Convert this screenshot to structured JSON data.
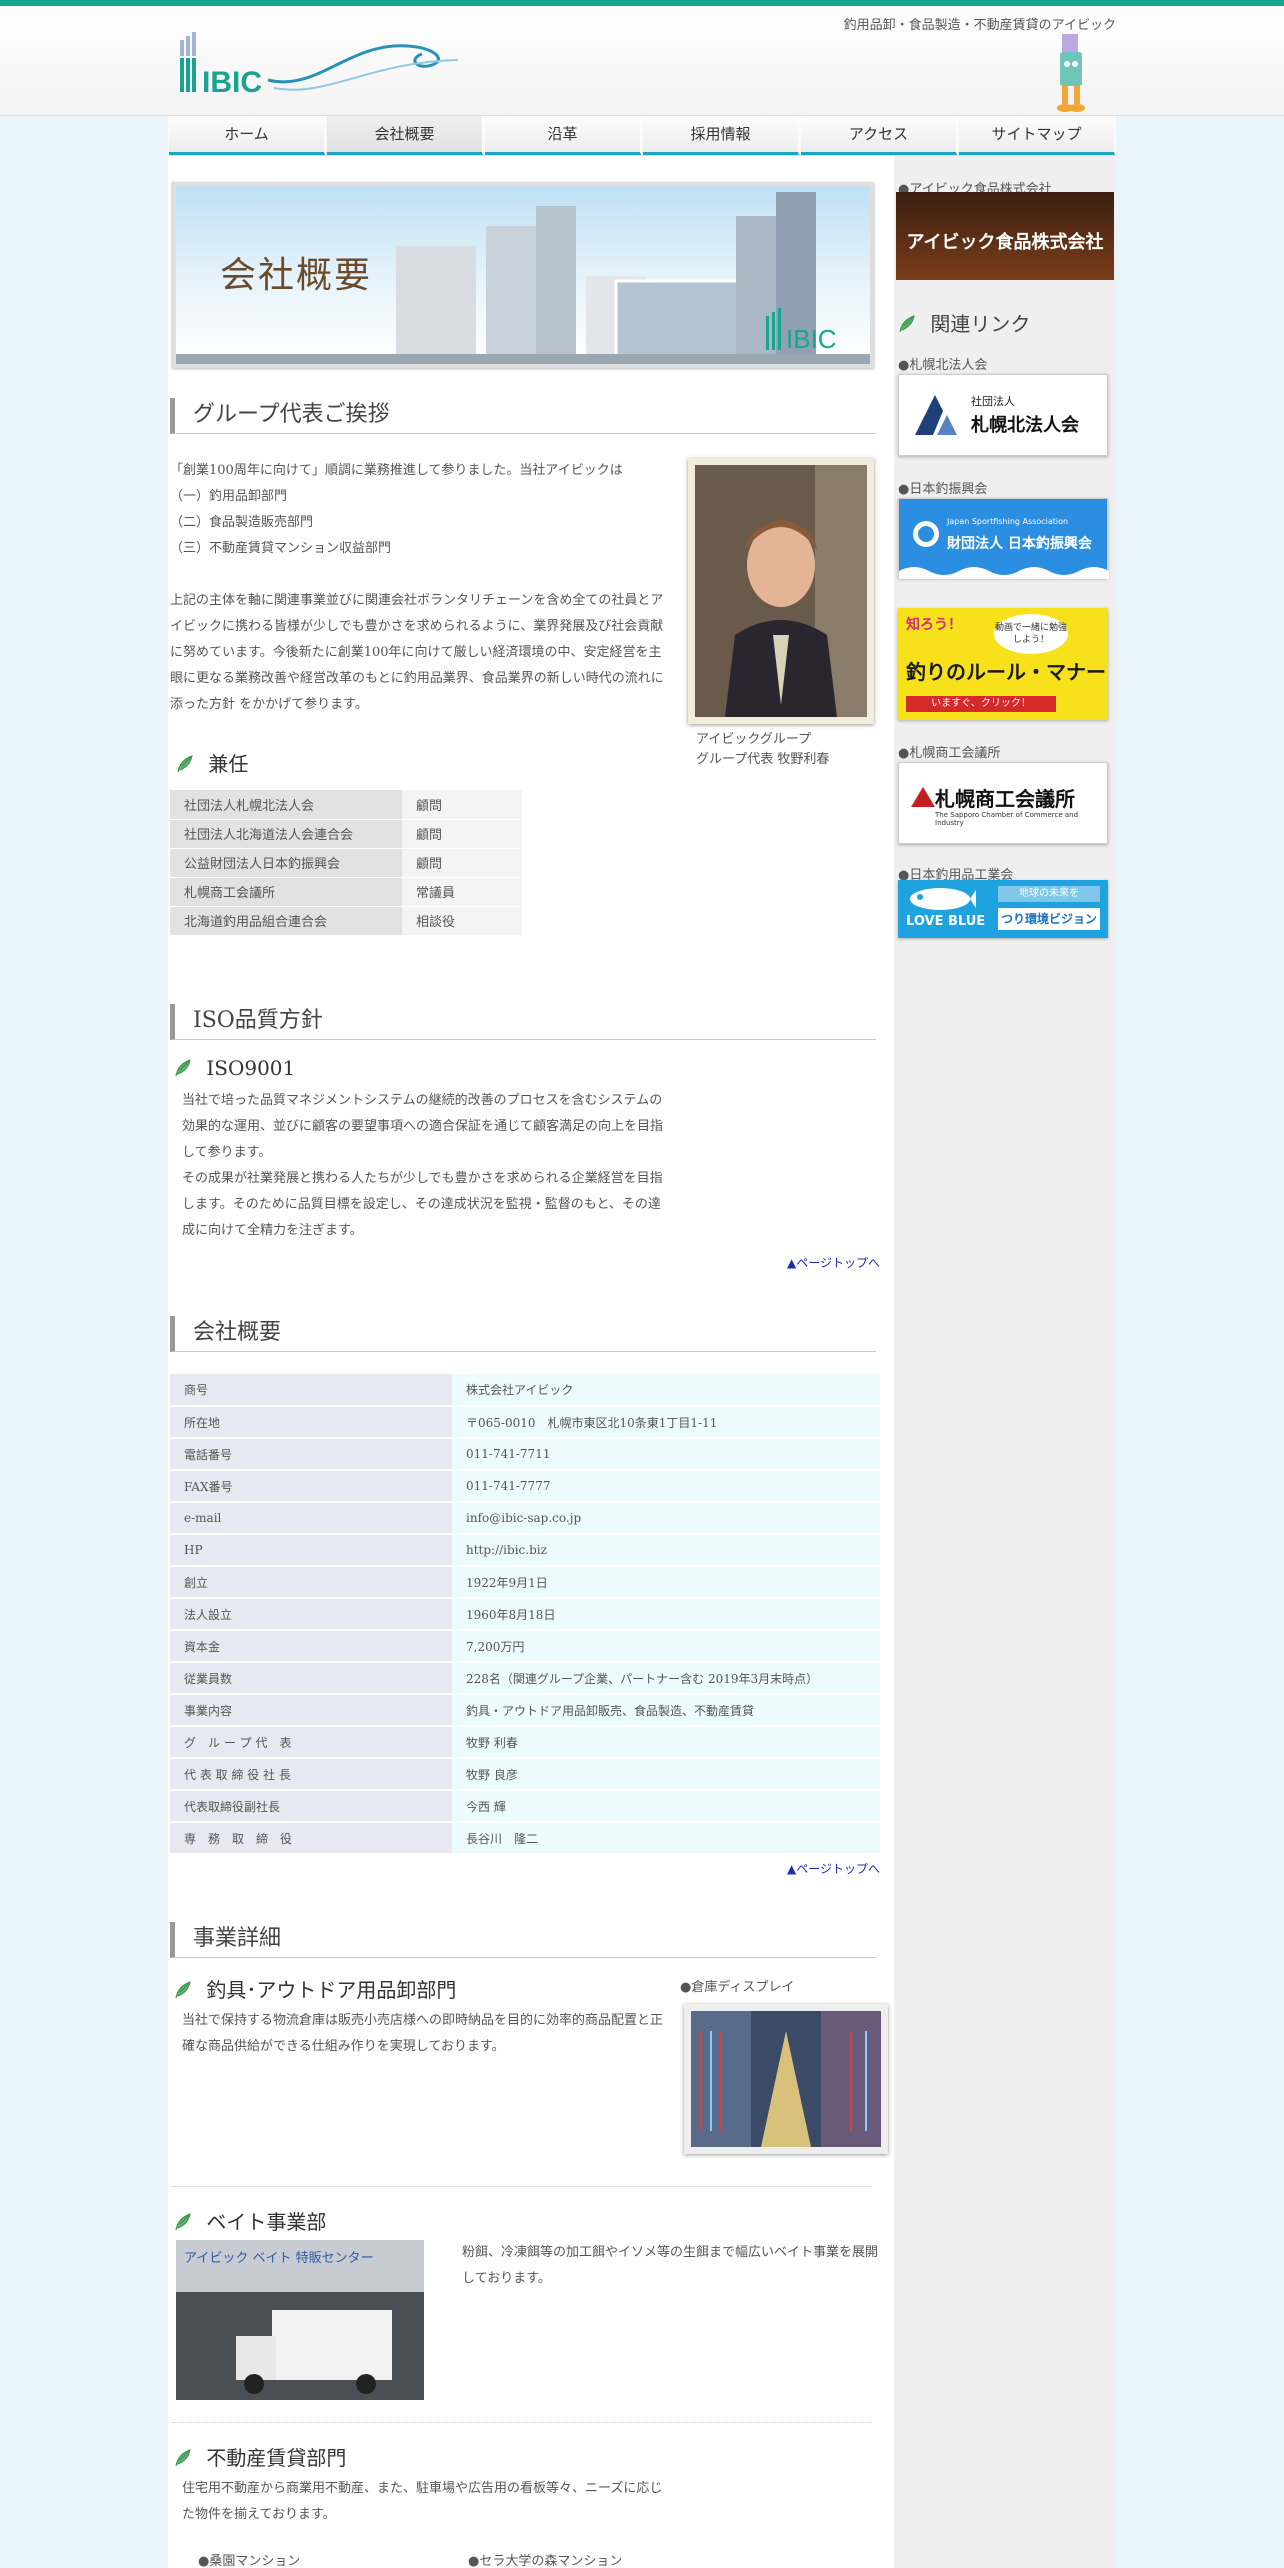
{
  "header": {
    "tagline": "釣用品卸・食品製造・不動産賃貸のアイビック",
    "logo_text": "IBIC"
  },
  "nav": [
    {
      "label": "ホーム"
    },
    {
      "label": "会社概要"
    },
    {
      "label": "沿革"
    },
    {
      "label": "採用情報"
    },
    {
      "label": "アクセス"
    },
    {
      "label": "サイトマップ"
    }
  ],
  "banner": {
    "title": "会社概要",
    "logo_text": "IBIC"
  },
  "greeting": {
    "heading": "グループ代表ご挨拶",
    "lines": [
      "「創業100周年に向けて」順調に業務推進して参りました。当社アイビックは",
      "（一）釣用品卸部門",
      "（二）食品製造販売部門",
      "（三）不動産賃貸マンション収益部門"
    ],
    "body": [
      "上記の主体を軸に関連事業並びに関連会社ボランタリチェーンを含め全ての社員とア",
      "イビックに携わる皆様が少しでも豊かさを求められるように、業界発展及び社会貢献",
      "に努めています。今後新たに創業100年に向けて厳しい経済環境の中、安定経営を主",
      "眼に更なる業務改善や経営改革のもとに釣用品業界、食品業界の新しい時代の流れに",
      "添った方針 をかかげて参ります。"
    ],
    "caption_line1": "アイビックグループ",
    "caption_line2": "グループ代表 牧野利春"
  },
  "roles": {
    "heading": "兼任",
    "rows": [
      {
        "org": "社団法人札幌北法人会",
        "role": "顧問"
      },
      {
        "org": "社団法人北海道法人会連合会",
        "role": "顧問"
      },
      {
        "org": "公益財団法人日本釣振興会",
        "role": "顧問"
      },
      {
        "org": "札幌商工会議所",
        "role": "常議員"
      },
      {
        "org": "北海道釣用品組合連合会",
        "role": "相談役"
      }
    ]
  },
  "iso": {
    "heading": "ISO品質方針",
    "subheading": "ISO9001",
    "lines": [
      "当社で培った品質マネジメントシステムの継続的改善のプロセスを含むシステムの",
      "効果的な運用、並びに顧客の要望事項への適合保証を通じて顧客満足の向上を目指",
      "して参ります。",
      "その成果が社業発展と携わる人たちが少しでも豊かさを求められる企業経営を目指",
      "します。そのために品質目標を設定し、その達成状況を監視・監督のもと、その達",
      "成に向けて全精力を注ぎます。"
    ],
    "pagetop": "▲ページトップへ"
  },
  "profile": {
    "heading": "会社概要",
    "rows": [
      {
        "k": "商号",
        "v": "株式会社アイビック"
      },
      {
        "k": "所在地",
        "v": "〒065-0010　札幌市東区北10条東1丁目1-11"
      },
      {
        "k": "電話番号",
        "v": "011-741-7711"
      },
      {
        "k": "FAX番号",
        "v": "011-741-7777"
      },
      {
        "k": "e-mail",
        "v": "info@ibic-sap.co.jp"
      },
      {
        "k": "HP",
        "v": "http://ibic.biz"
      },
      {
        "k": "創立",
        "v": "1922年9月1日"
      },
      {
        "k": "法人設立",
        "v": "1960年8月18日"
      },
      {
        "k": "資本金",
        "v": "7,200万円"
      },
      {
        "k": "従業員数",
        "v": "228名（関連グループ企業、パートナー含む 2019年3月末時点）"
      },
      {
        "k": "事業内容",
        "v": "釣具・アウトドア用品卸販売、食品製造、不動産賃貸"
      },
      {
        "k": "グ　ル ー プ 代　表",
        "v": "牧野 利春"
      },
      {
        "k": "代 表 取 締 役 社 長",
        "v": "牧野 良彦"
      },
      {
        "k": "代表取締役副社長",
        "v": "今西 輝"
      },
      {
        "k": "専　務　取　締　役",
        "v": "長谷川　隆二"
      }
    ],
    "pagetop": "▲ページトップへ"
  },
  "business": {
    "heading": "事業詳細",
    "fishing": {
      "title": "釣具･アウトドア用品卸部門",
      "lines": [
        "当社で保持する物流倉庫は販売小売店様への即時納品を目的に効率的商品配置と正",
        "確な商品供給ができる仕組み作りを実現しております。"
      ],
      "photo_label": "●倉庫ディスプレイ"
    },
    "bait": {
      "title": "ベイト事業部",
      "lines": [
        "粉餌、冷凍餌等の加工餌やイソメ等の生餌まで幅広いベイト事業を展開",
        "しております。"
      ],
      "photo_sign": "アイビック ベイト 特販センター"
    },
    "realestate": {
      "title": "不動産賃貸部門",
      "lines": [
        "住宅用不動産から商業用不動産、また、駐車場や広告用の看板等々、ニーズに応じ",
        "た物件を揃えております。"
      ],
      "items": [
        "●桑園マンション",
        "●セラ大学の森マンション"
      ]
    }
  },
  "sidebar": {
    "food_label": "●アイビック食品株式会社",
    "food_banner": "アイビック食品株式会社",
    "links_heading": "関連リンク",
    "links": [
      {
        "label": "●札幌北法人会",
        "banner_small": "社団法人",
        "banner_main": "札幌北法人会"
      },
      {
        "label": "●日本釣振興会",
        "banner_small": "Japan Sportfishing Association",
        "banner_main": "財団法人 日本釣振興会"
      },
      {
        "label": "",
        "banner_small": "知ろう！",
        "banner_main": "釣りのルール・マナー",
        "banner_sub": "動画で一緒に勉強しよう！",
        "banner_click": "いますぐ、クリック！"
      },
      {
        "label": "●札幌商工会議所",
        "banner_main": "札幌商工会議所",
        "banner_small": "The Sapporo Chamber of Commerce and Industry"
      },
      {
        "label": "●日本釣用品工業会",
        "banner_main": "LOVE BLUE",
        "banner_small": "地球の未来を",
        "banner_sub": "つり環境ビジョン"
      }
    ]
  },
  "colors": {
    "accent": "#18a48e",
    "nav_underline": "#1aa7bc",
    "link": "#1a2fa8"
  }
}
